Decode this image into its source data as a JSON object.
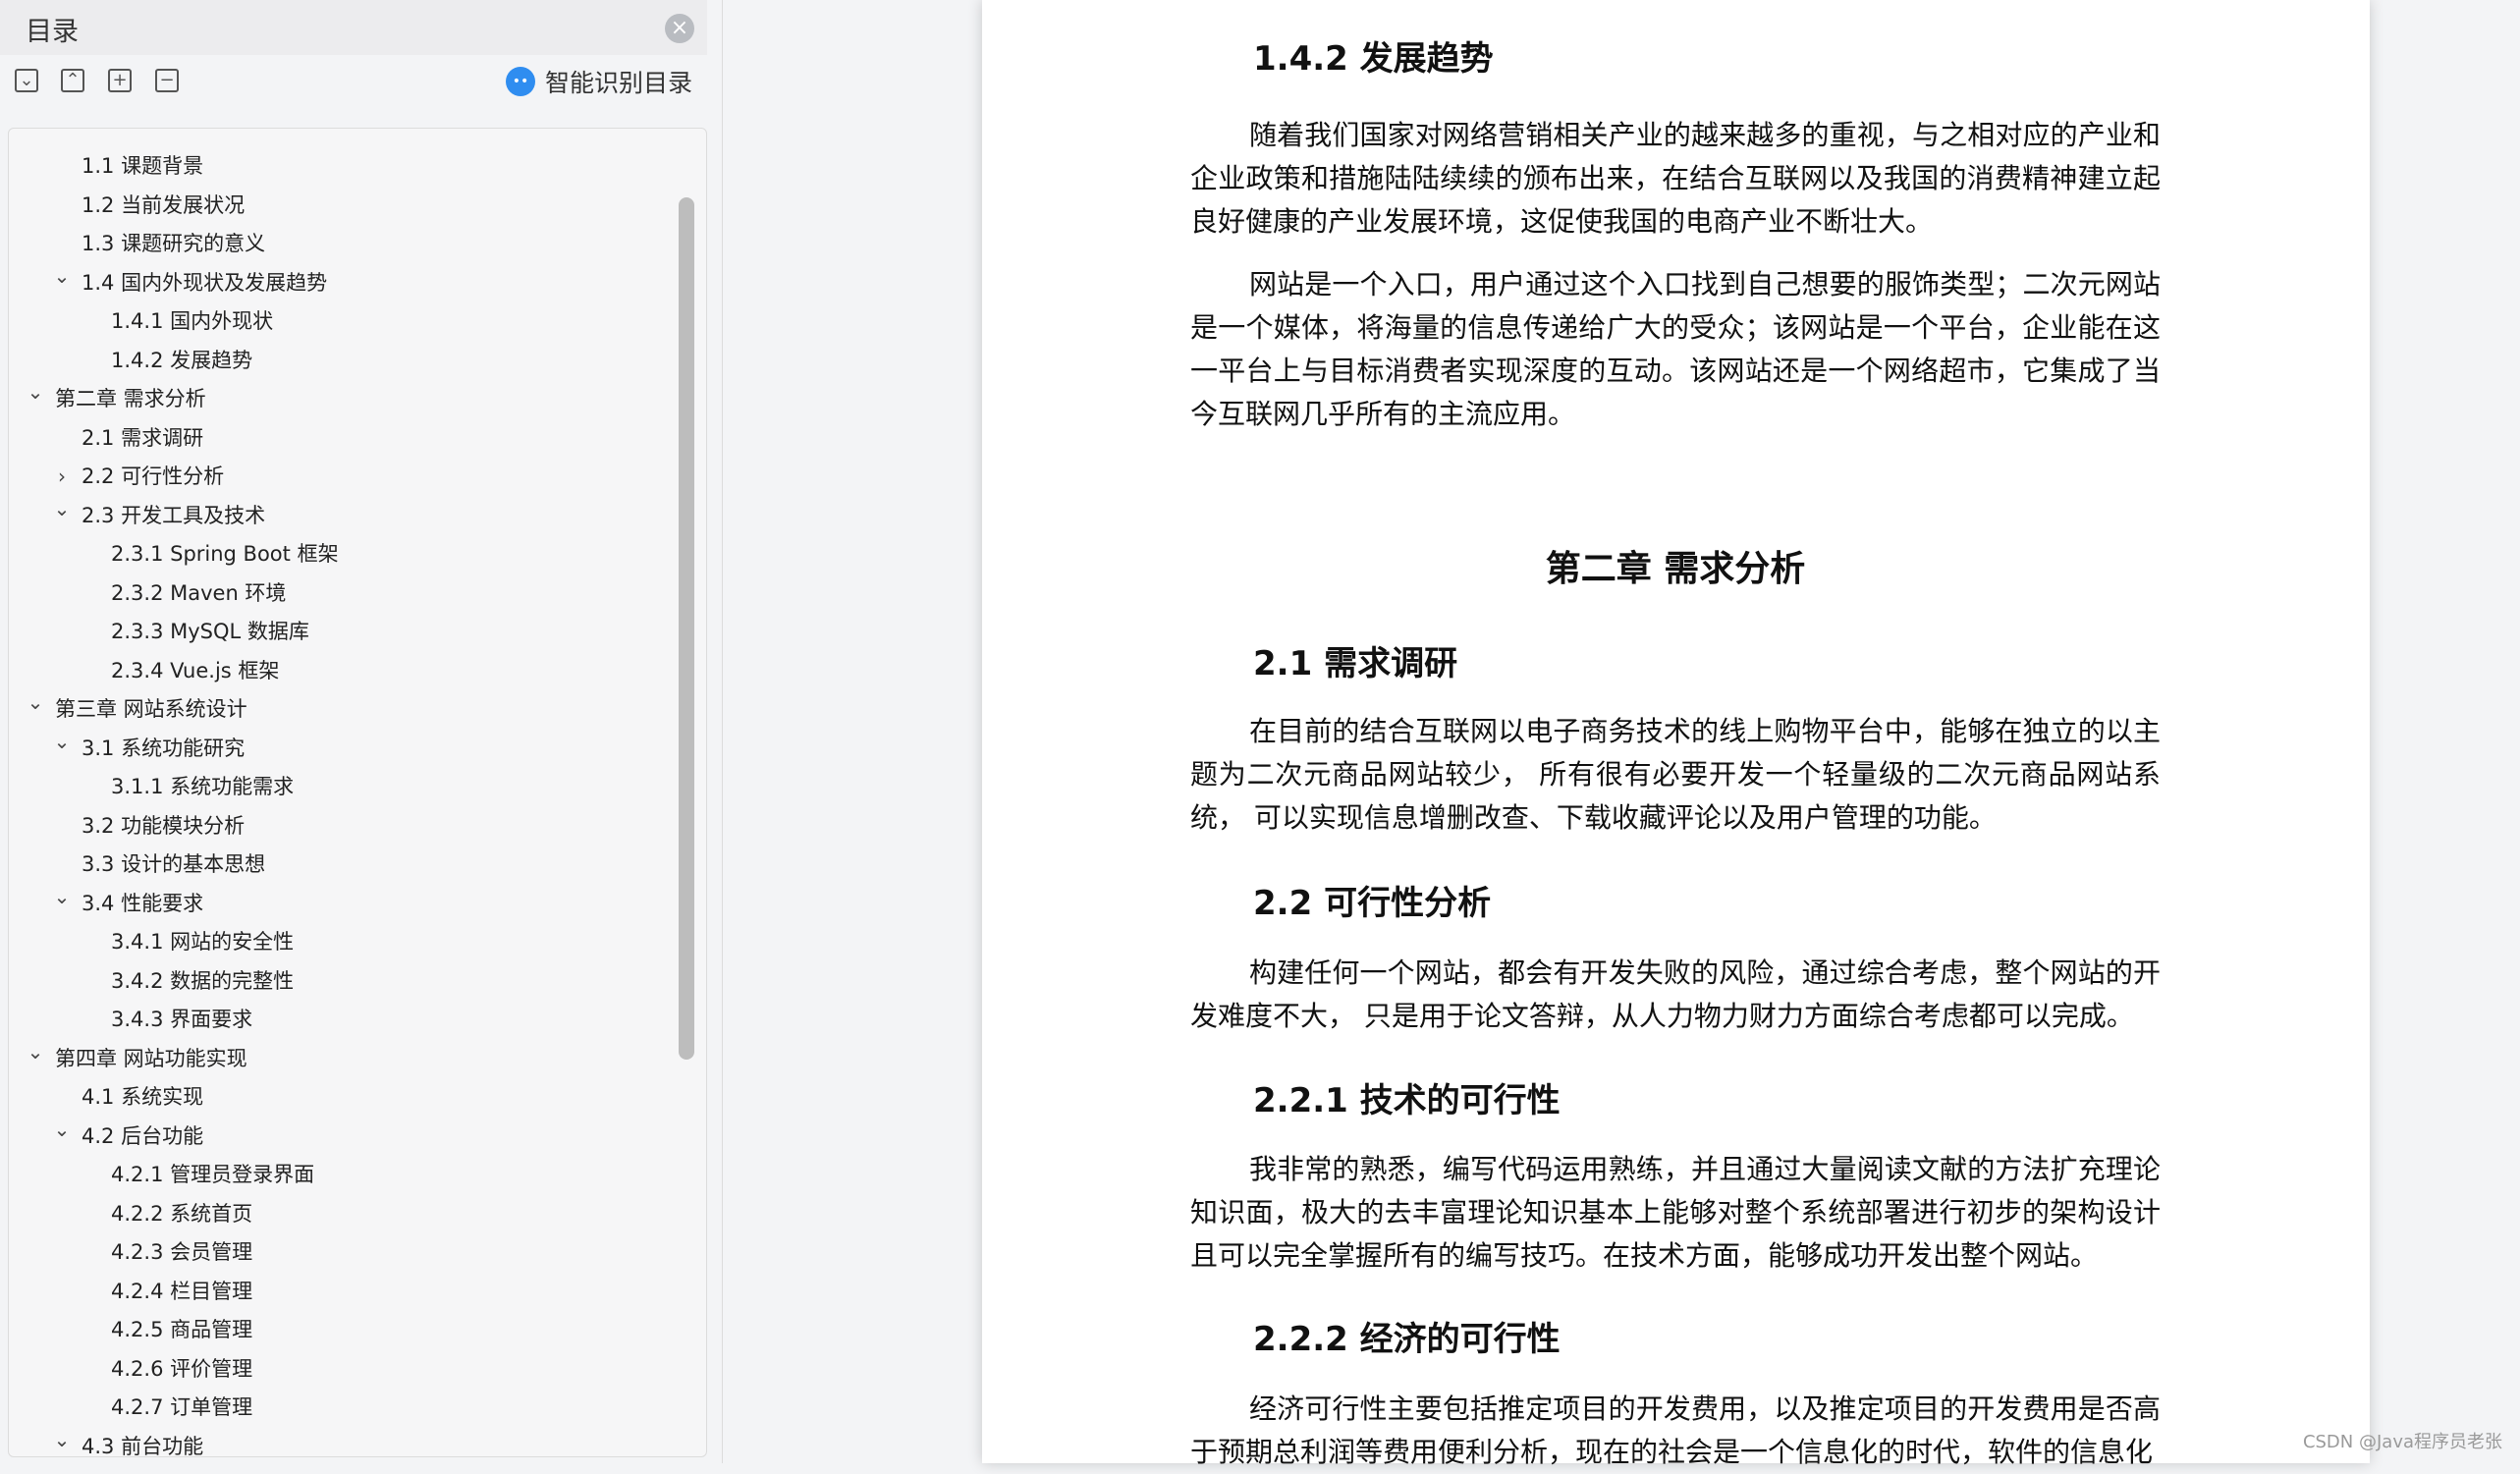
{
  "sidebar": {
    "title": "目录",
    "smart_label": "智能识别目录",
    "toc": [
      {
        "label": "1.1 课题背景"
      },
      {
        "label": "1.2 当前发展状况"
      },
      {
        "label": "1.3 课题研究的意义"
      },
      {
        "label": "1.4  国内外现状及发展趋势",
        "chevron": "down"
      },
      {
        "label": "1.4.1  国内外现状"
      },
      {
        "label": "1.4.2  发展趋势"
      },
      {
        "label": "第二章  需求分析",
        "chevron": "down"
      },
      {
        "label": "2.1 需求调研"
      },
      {
        "label": "2.2 可行性分析",
        "chevron": "right"
      },
      {
        "label": "2.3 开发工具及技术",
        "chevron": "down"
      },
      {
        "label": "2.3.1 Spring Boot 框架"
      },
      {
        "label": "2.3.2 Maven 环境"
      },
      {
        "label": "2.3.3 MySQL 数据库"
      },
      {
        "label": "2.3.4 Vue.js 框架"
      },
      {
        "label": "第三章  网站系统设计",
        "chevron": "down"
      },
      {
        "label": "3.1 系统功能研究",
        "chevron": "down"
      },
      {
        "label": "3.1.1 系统功能需求"
      },
      {
        "label": "3.2 功能模块分析"
      },
      {
        "label": "3.3  设计的基本思想"
      },
      {
        "label": "3.4  性能要求",
        "chevron": "down"
      },
      {
        "label": "3.4.1  网站的安全性"
      },
      {
        "label": "3.4.2  数据的完整性"
      },
      {
        "label": "3.4.3 界面要求"
      },
      {
        "label": "第四章  网站功能实现",
        "chevron": "down"
      },
      {
        "label": "4.1 系统实现"
      },
      {
        "label": "4.2  后台功能",
        "chevron": "down"
      },
      {
        "label": "4.2.1  管理员登录界面"
      },
      {
        "label": "4.2.2  系统首页"
      },
      {
        "label": "4.2.3  会员管理"
      },
      {
        "label": "4.2.4  栏目管理"
      },
      {
        "label": "4.2.5  商品管理"
      },
      {
        "label": "4.2.6  评价管理"
      },
      {
        "label": "4.2.7  订单管理"
      },
      {
        "label": "4.3 前台功能",
        "chevron": "down"
      }
    ]
  },
  "document": {
    "h_142": "1.4.2  发展趋势",
    "p1": "随着我们国家对网络营销相关产业的越来越多的重视，与之相对应的产业和企业政策和措施陆陆续续的颁布出来，在结合互联网以及我国的消费精神建立起良好健康的产业发展环境，这促使我国的电商产业不断壮大。",
    "p2": "网站是一个入口，用户通过这个入口找到自己想要的服饰类型；二次元网站是一个媒体，将海量的信息传递给广大的受众；该网站是一个平台，企业能在这一平台上与目标消费者实现深度的互动。该网站还是一个网络超市，它集成了当今互联网几乎所有的主流应用。",
    "chapter2": "第二章  需求分析",
    "h_21": "2.1 需求调研",
    "p3": "在目前的结合互联网以电子商务技术的线上购物平台中，能够在独立的以主题为二次元商品网站较少， 所有很有必要开发一个轻量级的二次元商品网站系统， 可以实现信息增删改查、下载收藏评论以及用户管理的功能。",
    "h_22": "2.2 可行性分析",
    "p4": "构建任何一个网站，都会有开发失败的风险，通过综合考虑，整个网站的开发难度不大， 只是用于论文答辩，从人力物力财力方面综合考虑都可以完成。",
    "h_221": "2.2.1 技术的可行性",
    "p5": "我非常的熟悉，编写代码运用熟练，并且通过大量阅读文献的方法扩充理论知识面，极大的去丰富理论知识基本上能够对整个系统部署进行初步的架构设计且可以完全掌握所有的编写技巧。在技术方面，能够成功开发出整个网站。",
    "h_222": "2.2.2 经济的可行性",
    "p6": "经济可行性主要包括推定项目的开发费用，以及推定项目的开发费用是否高于预期总利润等费用便利分析，现在的社会是一个信息化的时代，软件的信息化"
  },
  "watermark": "CSDN @Java程序员老张"
}
